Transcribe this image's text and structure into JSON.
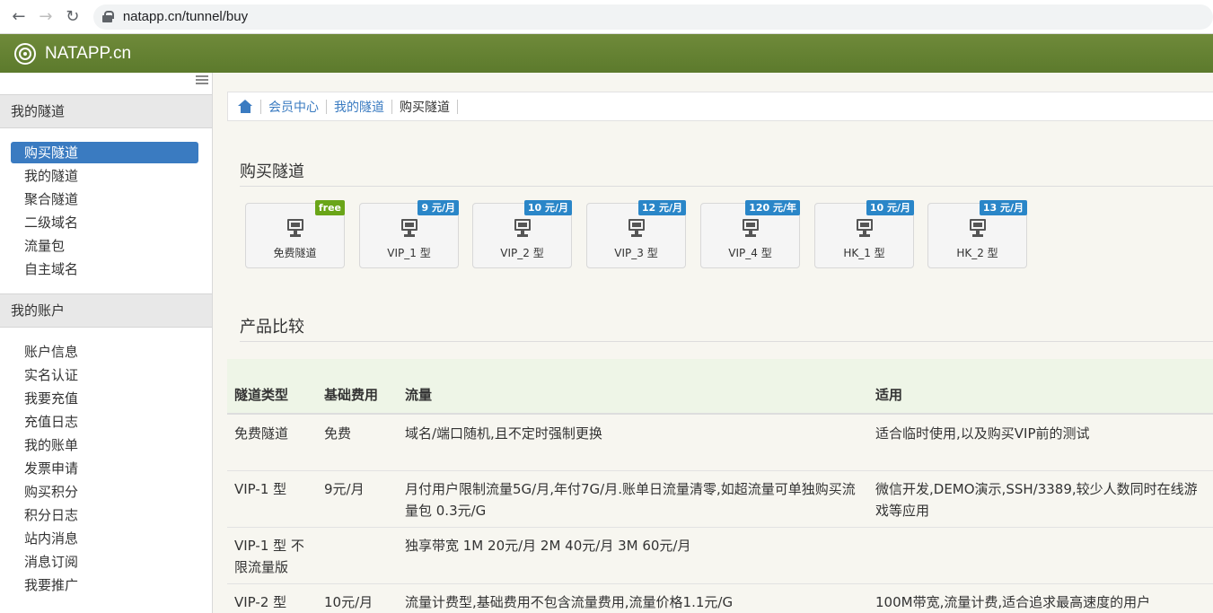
{
  "browser": {
    "url": "natapp.cn/tunnel/buy"
  },
  "app": {
    "brand": "NATAPP.cn"
  },
  "sidebar": {
    "sections": [
      {
        "title": "我的隧道",
        "items": [
          "购买隧道",
          "我的隧道",
          "聚合隧道",
          "二级域名",
          "流量包",
          "自主域名"
        ]
      },
      {
        "title": "我的账户",
        "items": [
          "账户信息",
          "实名认证",
          "我要充值",
          "充值日志",
          "我的账单",
          "发票申请",
          "购买积分",
          "积分日志",
          "站内消息",
          "消息订阅",
          "我要推广"
        ]
      }
    ],
    "active_item": "购买隧道"
  },
  "breadcrumb": [
    "会员中心",
    "我的隧道",
    "购买隧道"
  ],
  "buy_section": {
    "heading": "购买隧道"
  },
  "plans": [
    {
      "name": "免费隧道",
      "price": "free"
    },
    {
      "name": "VIP_1 型",
      "price": "9 元/月"
    },
    {
      "name": "VIP_2 型",
      "price": "10 元/月"
    },
    {
      "name": "VIP_3 型",
      "price": "12 元/月"
    },
    {
      "name": "VIP_4 型",
      "price": "120 元/年"
    },
    {
      "name": "HK_1 型",
      "price": "10 元/月"
    },
    {
      "name": "HK_2 型",
      "price": "13 元/月"
    }
  ],
  "compare_section": {
    "heading": "产品比较"
  },
  "compare_table": {
    "headers": [
      "隧道类型",
      "基础费用",
      "流量",
      "适用"
    ],
    "rows": [
      {
        "type": "免费隧道",
        "fee": "免费",
        "traffic": "域名/端口随机,且不定时强制更换",
        "usage": "适合临时使用,以及购买VIP前的测试"
      },
      {
        "type": "VIP-1 型",
        "fee": "9元/月",
        "traffic": "月付用户限制流量5G/月,年付7G/月.账单日流量清零,如超流量可单独购买流量包 0.3元/G",
        "usage": "微信开发,DEMO演示,SSH/3389,较少人数同时在线游戏等应用"
      },
      {
        "type": "VIP-1 型 不限流量版",
        "fee": "",
        "traffic": "独享带宽 1M 20元/月 2M 40元/月 3M 60元/月",
        "usage": ""
      },
      {
        "type": "VIP-2 型",
        "fee": "10元/月",
        "traffic": "流量计费型,基础费用不包含流量费用,流量价格1.1元/G",
        "usage": "100M带宽,流量计费,适合追求最高速度的用户"
      }
    ]
  }
}
